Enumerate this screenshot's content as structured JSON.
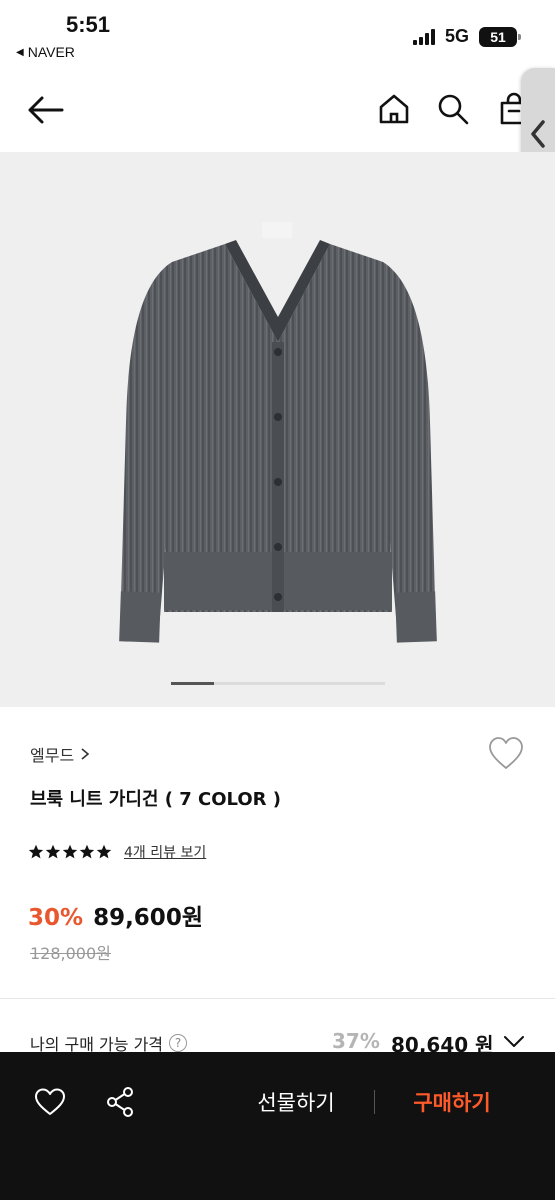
{
  "status_bar": {
    "time": "5:51",
    "back_app": "NAVER",
    "network": "5G",
    "battery": "51"
  },
  "header": {
    "back_icon": "arrow-left-icon",
    "home_icon": "home-icon",
    "search_icon": "search-icon",
    "cart_icon": "shopping-bag-icon"
  },
  "product": {
    "brand": "엘무드",
    "name": "브룩 니트 가디건 ( 7 COLOR )",
    "rating_stars": 5,
    "review_link": "4개 리뷰 보기",
    "discount": "30%",
    "price": "89,600원",
    "original_price": "128,000원",
    "image_label": "cardigan-image",
    "image_count_active": 1
  },
  "my_price": {
    "label": "나의 구매 가능 가격",
    "help": "?",
    "discount": "37%",
    "price": "80,640 원"
  },
  "bottom_bar": {
    "gift_label": "선물하기",
    "buy_label": "구매하기"
  },
  "colors": {
    "accent": "#e8572e",
    "buy": "#ff5a2a",
    "bar_bg": "#111111"
  }
}
